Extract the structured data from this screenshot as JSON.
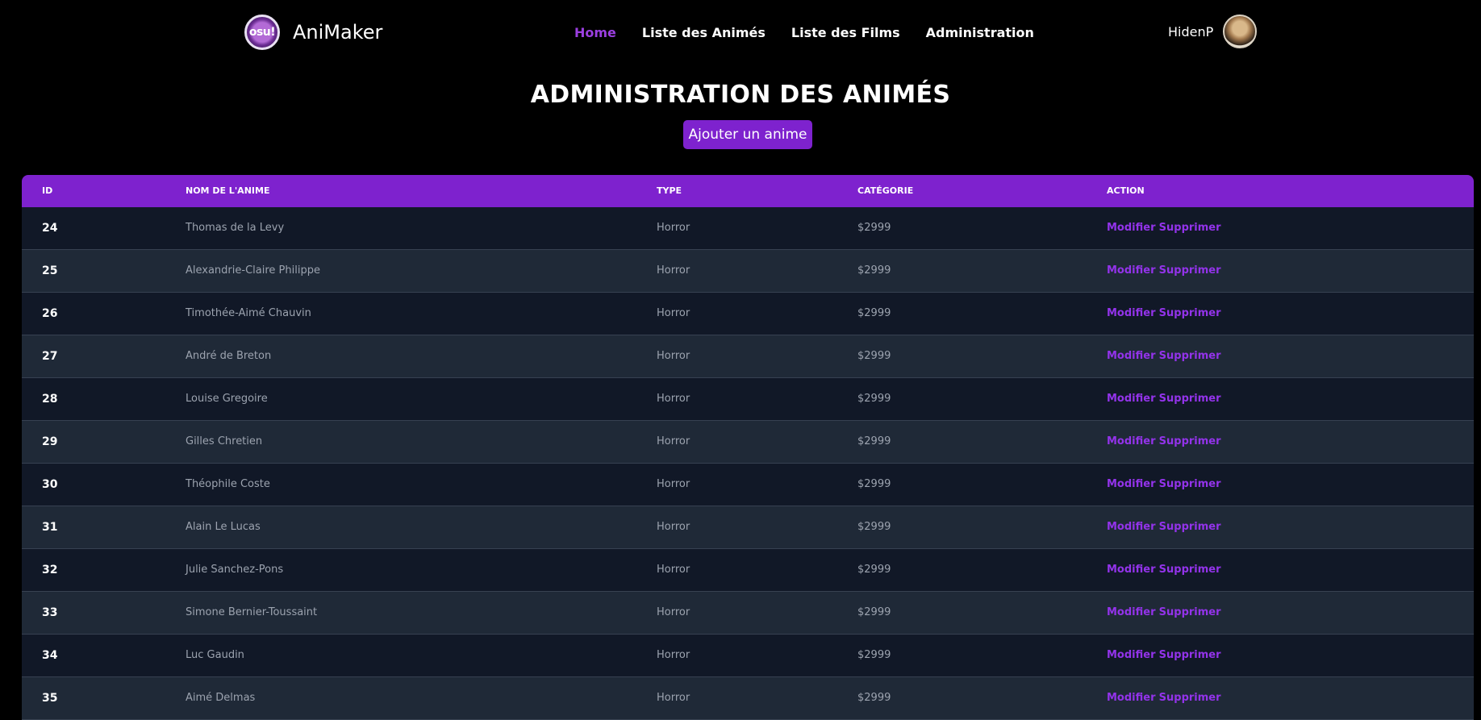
{
  "header": {
    "logo_text": "osu!",
    "brand": "AniMaker",
    "nav": [
      {
        "label": "Home",
        "active": true
      },
      {
        "label": "Liste des Animés",
        "active": false
      },
      {
        "label": "Liste des Films",
        "active": false
      },
      {
        "label": "Administration",
        "active": false
      }
    ],
    "username": "HidenP"
  },
  "page": {
    "title": "ADMINISTRATION DES ANIMÉS",
    "add_button": "Ajouter un anime"
  },
  "table": {
    "columns": [
      "ID",
      "NOM DE L'ANIME",
      "TYPE",
      "CATÉGORIE",
      "ACTION"
    ],
    "rows": [
      {
        "id": "24",
        "name": "Thomas de la Levy",
        "type": "Horror",
        "category": "$2999"
      },
      {
        "id": "25",
        "name": "Alexandrie-Claire Philippe",
        "type": "Horror",
        "category": "$2999"
      },
      {
        "id": "26",
        "name": "Timothée-Aimé Chauvin",
        "type": "Horror",
        "category": "$2999"
      },
      {
        "id": "27",
        "name": "André de Breton",
        "type": "Horror",
        "category": "$2999"
      },
      {
        "id": "28",
        "name": "Louise Gregoire",
        "type": "Horror",
        "category": "$2999"
      },
      {
        "id": "29",
        "name": "Gilles Chretien",
        "type": "Horror",
        "category": "$2999"
      },
      {
        "id": "30",
        "name": "Théophile Coste",
        "type": "Horror",
        "category": "$2999"
      },
      {
        "id": "31",
        "name": "Alain Le Lucas",
        "type": "Horror",
        "category": "$2999"
      },
      {
        "id": "32",
        "name": "Julie Sanchez-Pons",
        "type": "Horror",
        "category": "$2999"
      },
      {
        "id": "33",
        "name": "Simone Bernier-Toussaint",
        "type": "Horror",
        "category": "$2999"
      },
      {
        "id": "34",
        "name": "Luc Gaudin",
        "type": "Horror",
        "category": "$2999"
      },
      {
        "id": "35",
        "name": "Aimé Delmas",
        "type": "Horror",
        "category": "$2999"
      }
    ],
    "edit_label": "Modifier",
    "delete_label": "Supprimer"
  },
  "colors": {
    "accent": "#7e22ce",
    "action_link": "#9333ea",
    "nav_active": "#9b3fe0",
    "row_dark": "#111827",
    "row_light": "#1f2937"
  }
}
